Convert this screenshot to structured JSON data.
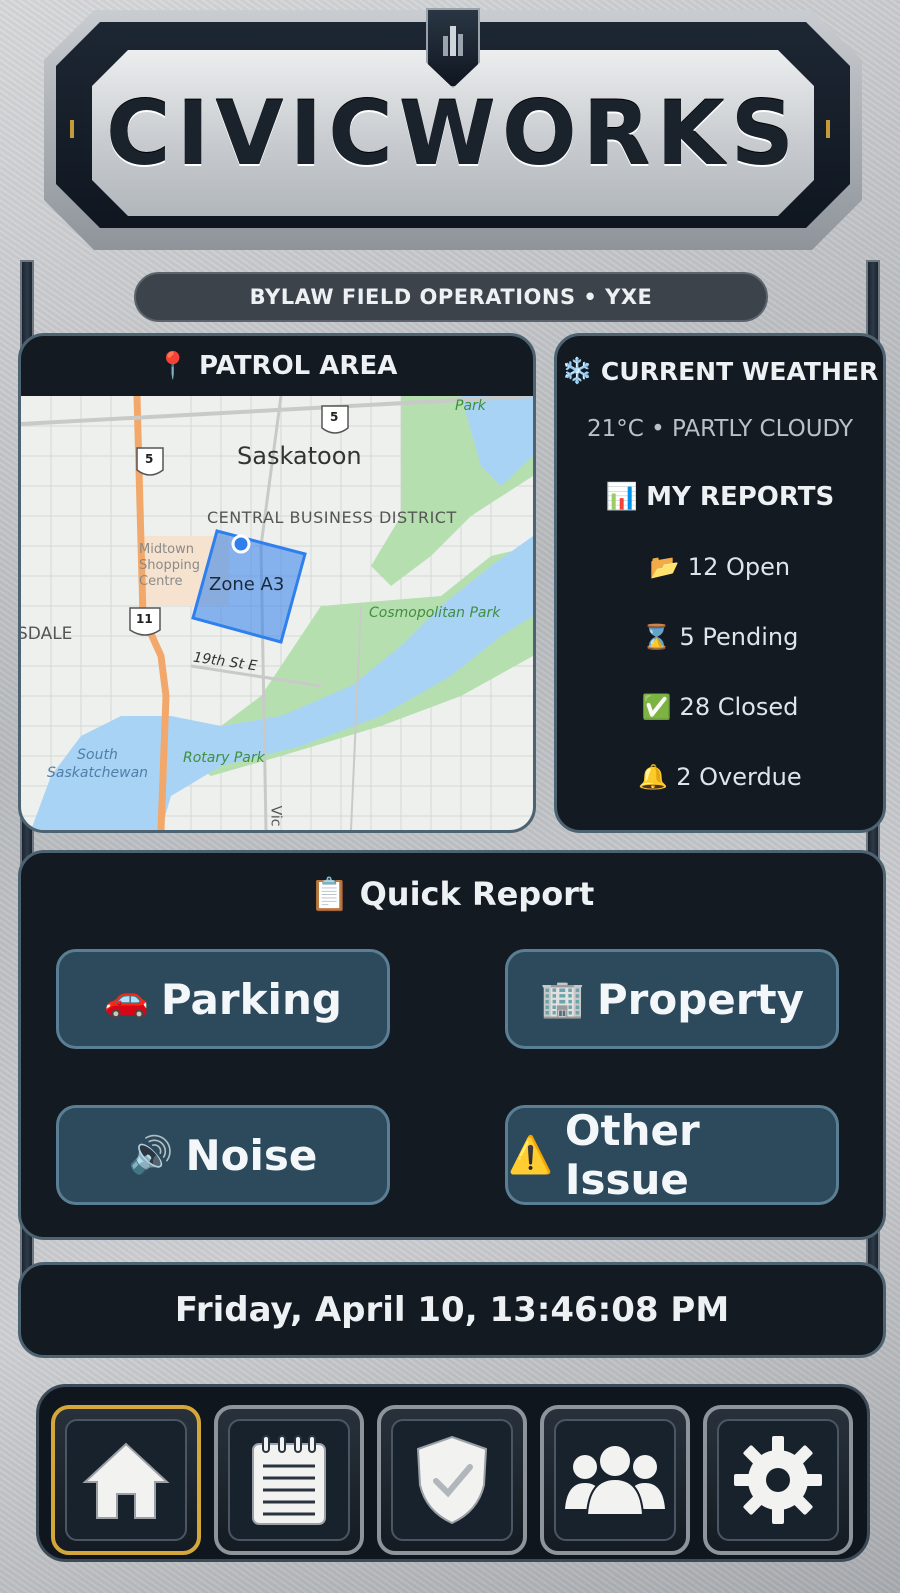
{
  "app": {
    "title": "CIVICWORKS",
    "subtitle": "BYLAW FIELD OPERATIONS • YXE"
  },
  "patrol": {
    "icon": "pin-icon",
    "icon_glyph": "📍",
    "title": "PATROL AREA",
    "map": {
      "city": "Saskatoon",
      "district": "CENTRAL BUSINESS DISTRICT",
      "zone": "Zone A3",
      "mall": [
        "Midtown",
        "Shopping",
        "Centre"
      ],
      "park1": "Park",
      "park2": "Cosmopolitan Park",
      "park3": "Rotary Park",
      "street": "19th St E",
      "neighbourhood": "SDALE",
      "river": [
        "South",
        "Saskatchewan"
      ],
      "vic": "Vic",
      "highway_shields": [
        "5",
        "5",
        "11"
      ]
    }
  },
  "weather": {
    "icon": "snowflake-icon",
    "icon_glyph": "❄️",
    "title": "CURRENT WEATHER",
    "condition": "21°C • PARTLY CLOUDY"
  },
  "reports": {
    "icon": "chart-icon",
    "icon_glyph": "📊",
    "title": "MY REPORTS",
    "items": [
      {
        "icon": "folder-icon",
        "glyph": "📂",
        "label": "12 Open"
      },
      {
        "icon": "hourglass-icon",
        "glyph": "⌛",
        "label": "5 Pending"
      },
      {
        "icon": "check-icon",
        "glyph": "✅",
        "label": "28 Closed"
      },
      {
        "icon": "bell-icon",
        "glyph": "🔔",
        "label": "2 Overdue"
      }
    ]
  },
  "quick_report": {
    "icon": "clipboard-icon",
    "icon_glyph": "📋",
    "title": "Quick Report",
    "buttons": [
      {
        "icon": "car-icon",
        "glyph": "🚗",
        "label": "Parking"
      },
      {
        "icon": "building-icon",
        "glyph": "🏢",
        "label": "Property"
      },
      {
        "icon": "speaker-icon",
        "glyph": "🔊",
        "label": "Noise"
      },
      {
        "icon": "warning-icon",
        "glyph": "⚠️",
        "label": "Other Issue"
      }
    ]
  },
  "datetime": "Friday, April 10, 13:46:08 PM",
  "nav": {
    "items": [
      {
        "icon": "home-icon",
        "active": true
      },
      {
        "icon": "notepad-icon",
        "active": false
      },
      {
        "icon": "shield-check-icon",
        "active": false
      },
      {
        "icon": "team-icon",
        "active": false
      },
      {
        "icon": "gear-icon",
        "active": false
      }
    ]
  },
  "colors": {
    "panel": "#131a22",
    "panel_border": "#4e6372",
    "button": "#2c4a5c",
    "active_nav": "#d4a73a",
    "zone": "#2f80ed"
  }
}
